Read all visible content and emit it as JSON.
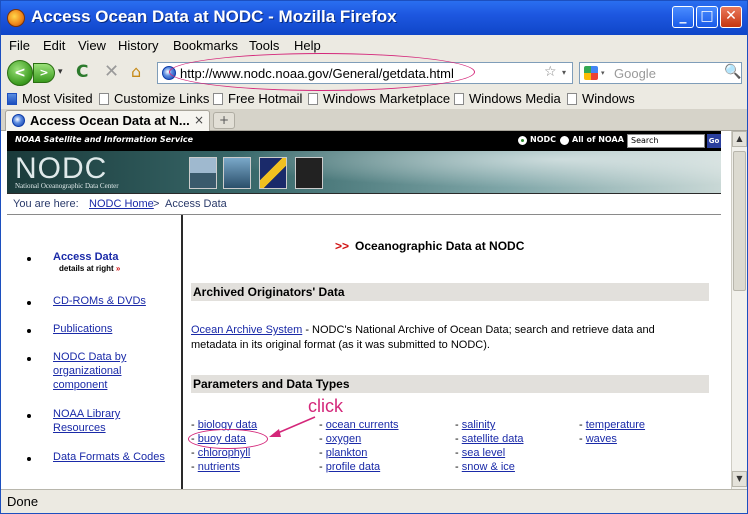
{
  "window": {
    "title": "Access Ocean Data at NODC - Mozilla Firefox",
    "minimize": "_",
    "maximize": "□",
    "close": "✕"
  },
  "menubar": [
    "File",
    "Edit",
    "View",
    "History",
    "Bookmarks",
    "Tools",
    "Help"
  ],
  "toolbar": {
    "back": "<",
    "forward": ">",
    "history_dropdown": "▾",
    "reload": "C",
    "stop": "✕",
    "home": "⌂",
    "url": "http://www.nodc.noaa.gov/General/getdata.html",
    "bookmark_star": "☆",
    "url_dropdown": "▾",
    "search_dropdown": "▾",
    "search_placeholder": "Google",
    "search_go": "🔍"
  },
  "bookmarks": [
    "Most Visited",
    "Customize Links",
    "Free Hotmail",
    "Windows Marketplace",
    "Windows Media",
    "Windows"
  ],
  "tabs": {
    "active_label": "Access Ocean Data at N...",
    "close": "×",
    "new_tab": "+"
  },
  "noaa": {
    "service_label": "NOAA Satellite and Information Service",
    "radio_nodc": "NODC",
    "radio_all": "All of NOAA",
    "search_value": "Search",
    "go": "Go",
    "logo": "NODC",
    "logo_sub": "National Oceanographic Data Center"
  },
  "breadcrumb": {
    "prefix": "You are here:",
    "home": "NODC Home",
    "sep": ">",
    "current": "Access Data"
  },
  "leftnav": {
    "access": "Access Data",
    "details": "details at right",
    "details_arrow": "»",
    "items": [
      "CD-ROMs & DVDs",
      "Publications",
      "NODC Data by organizational component",
      "NOAA Library Resources",
      "Data Formats & Codes"
    ]
  },
  "main": {
    "title_arrow": ">>",
    "title": "Oceanographic Data at NODC",
    "section1": "Archived Originators' Data",
    "archive_link": "Ocean Archive System",
    "archive_desc": " - NODC's National Archive of Ocean Data; search and retrieve data and metadata in its original format (as it was submitted to NODC).",
    "section2": "Parameters and Data Types",
    "params": {
      "col1": [
        "biology data",
        "buoy data",
        "chlorophyll",
        "nutrients"
      ],
      "col2": [
        "ocean currents",
        "oxygen",
        "plankton",
        "profile data"
      ],
      "col3": [
        "salinity",
        "satellite data",
        "sea level",
        "snow & ice"
      ],
      "col4": [
        "temperature",
        "waves"
      ]
    }
  },
  "annotation": {
    "click_label": "click",
    "color": "#d4277a"
  },
  "scrollbar": {
    "up": "▲",
    "down": "▼"
  },
  "status": {
    "text": "Done"
  }
}
